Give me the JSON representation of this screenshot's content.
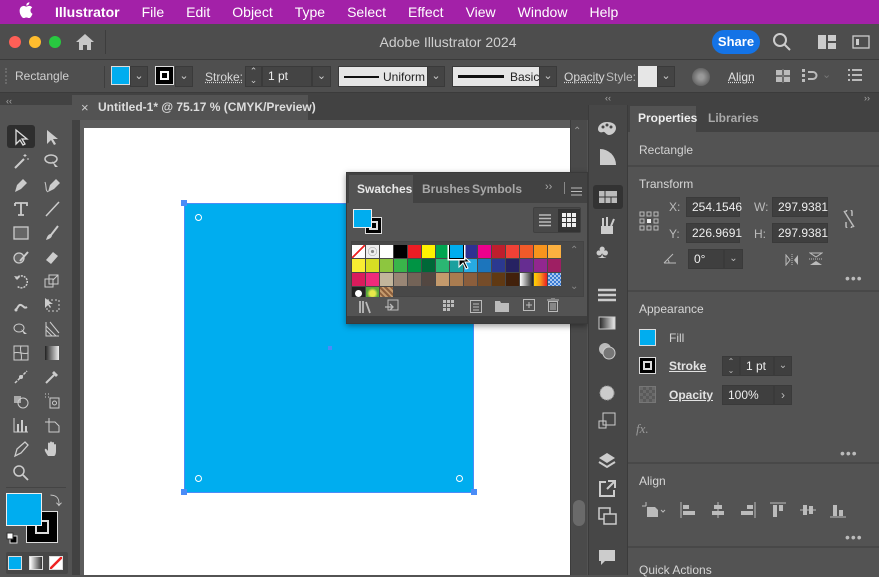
{
  "menubar": {
    "app": "Illustrator",
    "items": [
      "File",
      "Edit",
      "Object",
      "Type",
      "Select",
      "Effect",
      "View",
      "Window",
      "Help"
    ]
  },
  "window": {
    "title": "Adobe Illustrator 2024",
    "share_label": "Share"
  },
  "control_bar": {
    "object_type": "Rectangle",
    "stroke_label": "Stroke:",
    "stroke_weight": "1 pt",
    "profile": "Uniform",
    "brush": "Basic",
    "opacity_label": "Opacity",
    "style_label": "Style:",
    "align_label": "Align",
    "fill_color": "#00adef"
  },
  "document": {
    "tab_title": "Untitled-1* @ 75.17 % (CMYK/Preview)",
    "close": "×"
  },
  "swatches_panel": {
    "tabs": [
      "Swatches",
      "Brushes",
      "Symbols"
    ],
    "active_tab": "Swatches",
    "selected_swatch": "#00adef",
    "rows": [
      [
        "none",
        "registration",
        "#ffffff",
        "#000000",
        "#ed1c24",
        "#fff200",
        "#00a651",
        "#00adef",
        "#2e3192",
        "#ec008c",
        "#be1e2d",
        "#ef4136",
        "#f15a29",
        "#f7941d",
        "#fbb040"
      ],
      [
        "#f9ed32",
        "#d7df23",
        "#8dc63f",
        "#39b54a",
        "#009444",
        "#006838",
        "#2bb673",
        "#1ba09e",
        "#27aae1",
        "#1c75bc",
        "#2b3990",
        "#262262",
        "#662d91",
        "#92278f",
        "#9e1f63"
      ],
      [
        "#da1c5c",
        "#ee2a7b",
        "#c2b59b",
        "#998675",
        "#736357",
        "#534741",
        "#c49a6c",
        "#a97c50",
        "#8b5e3c",
        "#754c29",
        "#603913",
        "#42210b",
        "gradient-bw",
        "gradient-orange",
        "pattern-blue"
      ],
      [
        "pattern-dots",
        "pattern-flowers",
        "pattern-texture"
      ]
    ]
  },
  "properties_panel": {
    "tabs": [
      "Properties",
      "Libraries"
    ],
    "object_type": "Rectangle",
    "transform": {
      "title": "Transform",
      "x_label": "X:",
      "x": "254.1546",
      "y_label": "Y:",
      "y": "226.9691",
      "w_label": "W:",
      "w": "297.9381",
      "h_label": "H:",
      "h": "297.9381",
      "angle": "0°"
    },
    "appearance": {
      "title": "Appearance",
      "fill_label": "Fill",
      "stroke_label": "Stroke",
      "stroke_weight": "1 pt",
      "opacity_label": "Opacity",
      "opacity": "100%",
      "fx": "fx."
    },
    "align": {
      "title": "Align"
    },
    "quick_actions": {
      "title": "Quick Actions"
    }
  }
}
